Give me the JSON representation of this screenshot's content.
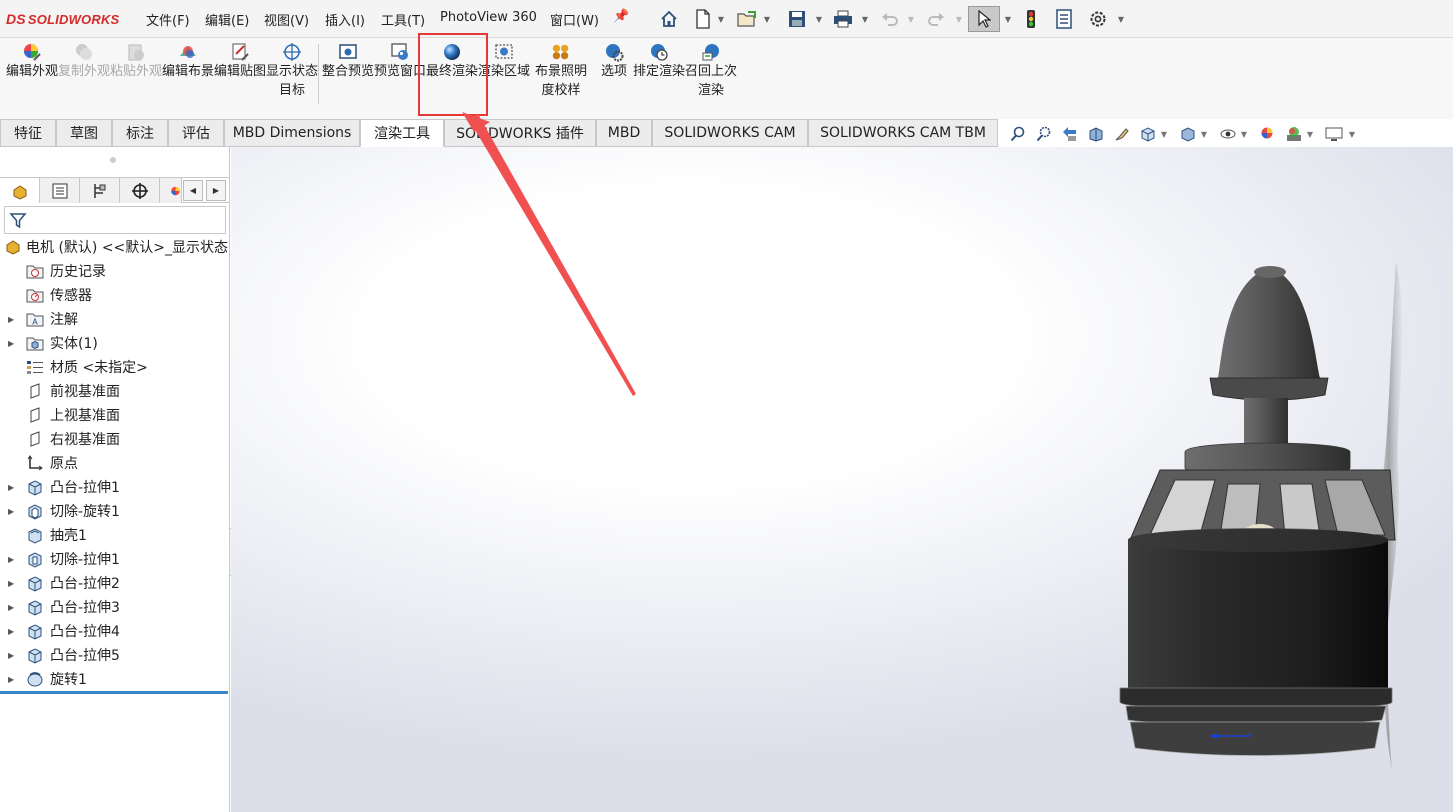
{
  "app": {
    "logo_text": "SOLIDWORKS",
    "logo_prefix": "DS"
  },
  "menu": [
    "文件(F)",
    "编辑(E)",
    "视图(V)",
    "插入(I)",
    "工具(T)",
    "PhotoView 360",
    "窗口(W)"
  ],
  "quick_access_icons": [
    "home-icon",
    "new-document-icon",
    "open-icon",
    "save-icon",
    "print-icon",
    "undo-icon",
    "redo-icon",
    "select-icon",
    "traffic-light-icon",
    "file-properties-icon",
    "options-gear-icon"
  ],
  "command_manager": {
    "buttons": [
      {
        "label": "编辑外观",
        "icon": "edit-appearance-icon",
        "enabled": true
      },
      {
        "label": "复制外观",
        "icon": "copy-appearance-icon",
        "enabled": false
      },
      {
        "label": "粘贴外观",
        "icon": "paste-appearance-icon",
        "enabled": false
      },
      {
        "label": "编辑布景",
        "icon": "edit-scene-icon",
        "enabled": true
      },
      {
        "label": "编辑贴图",
        "icon": "edit-decal-icon",
        "enabled": true
      },
      {
        "label": "显示状态目标",
        "icon": "display-state-target-icon",
        "enabled": true
      },
      {
        "label": "整合预览",
        "icon": "integrated-preview-icon",
        "enabled": true
      },
      {
        "label": "预览窗口",
        "icon": "preview-window-icon",
        "enabled": true
      },
      {
        "label": "最终渲染",
        "icon": "final-render-icon",
        "enabled": true,
        "highlighted": true
      },
      {
        "label": "渲染区域",
        "icon": "render-region-icon",
        "enabled": true
      },
      {
        "label": "布景照明度校样",
        "icon": "scene-illumination-proof-icon",
        "enabled": true
      },
      {
        "label": "选项",
        "icon": "options-icon",
        "enabled": true
      },
      {
        "label": "排定渲染",
        "icon": "schedule-render-icon",
        "enabled": true
      },
      {
        "label": "召回上次渲染",
        "icon": "recall-last-render-icon",
        "enabled": true
      }
    ]
  },
  "tabs": [
    "特征",
    "草图",
    "标注",
    "评估",
    "MBD Dimensions",
    "渲染工具",
    "SOLIDWORKS 插件",
    "MBD",
    "SOLIDWORKS CAM",
    "SOLIDWORKS CAM TBM"
  ],
  "active_tab": "渲染工具",
  "view_toolbar_icons": [
    "zoom-to-fit-icon",
    "zoom-area-icon",
    "previous-view-icon",
    "section-view-icon",
    "dynamic-annotation-icon",
    "view-orientation-icon",
    "display-style-icon",
    "hide-show-items-icon",
    "edit-appearance-icon",
    "apply-scene-icon",
    "view-settings-icon"
  ],
  "feature_tree": {
    "panel_tabs": [
      "featuremanager-icon",
      "propertymanager-icon",
      "configurationmanager-icon",
      "dimxpert-icon",
      "display-manager-icon"
    ],
    "root": "电机 (默认) <<默认>_显示状态",
    "items": [
      {
        "label": "历史记录",
        "icon": "history-folder-icon",
        "expandable": false
      },
      {
        "label": "传感器",
        "icon": "sensor-folder-icon",
        "expandable": false
      },
      {
        "label": "注解",
        "icon": "annotations-folder-icon",
        "expandable": true
      },
      {
        "label": "实体(1)",
        "icon": "solid-bodies-folder-icon",
        "expandable": true
      },
      {
        "label": "材质 <未指定>",
        "icon": "material-icon",
        "expandable": false
      },
      {
        "label": "前视基准面",
        "icon": "plane-icon",
        "expandable": false
      },
      {
        "label": "上视基准面",
        "icon": "plane-icon",
        "expandable": false
      },
      {
        "label": "右视基准面",
        "icon": "plane-icon",
        "expandable": false
      },
      {
        "label": "原点",
        "icon": "origin-icon",
        "expandable": false
      },
      {
        "label": "凸台-拉伸1",
        "icon": "boss-extrude-icon",
        "expandable": true
      },
      {
        "label": "切除-旋转1",
        "icon": "cut-revolve-icon",
        "expandable": true
      },
      {
        "label": "抽壳1",
        "icon": "shell-icon",
        "expandable": false
      },
      {
        "label": "切除-拉伸1",
        "icon": "cut-extrude-icon",
        "expandable": true
      },
      {
        "label": "凸台-拉伸2",
        "icon": "boss-extrude-icon",
        "expandable": true
      },
      {
        "label": "凸台-拉伸3",
        "icon": "boss-extrude-icon",
        "expandable": true
      },
      {
        "label": "凸台-拉伸4",
        "icon": "boss-extrude-icon",
        "expandable": true
      },
      {
        "label": "凸台-拉伸5",
        "icon": "boss-extrude-icon",
        "expandable": true
      },
      {
        "label": "旋转1",
        "icon": "revolve-icon",
        "expandable": true
      }
    ]
  },
  "colors": {
    "highlight_box": "#e53935",
    "annotation_arrow": "#f05050",
    "rollback_bar": "#3b86c6",
    "logo": "#d42a2a"
  }
}
